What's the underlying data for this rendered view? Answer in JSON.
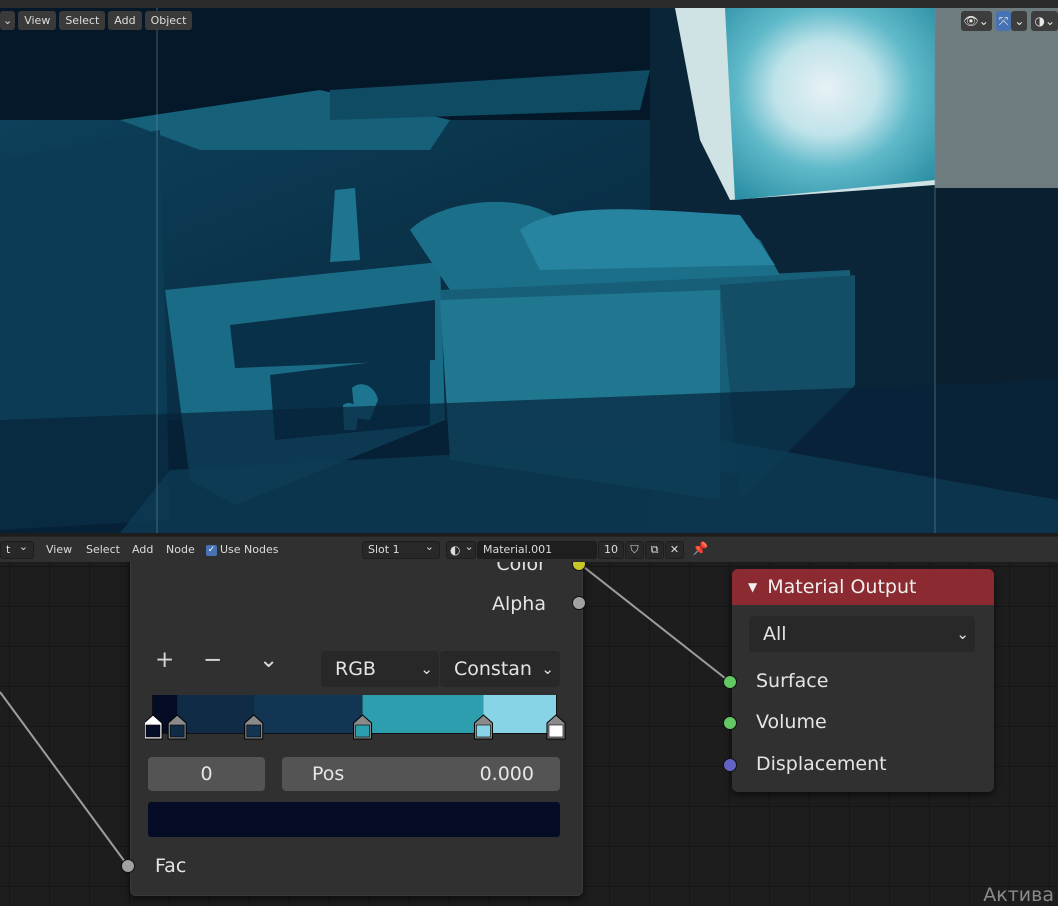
{
  "viewport": {
    "menu": [
      "View",
      "Select",
      "Add",
      "Object"
    ]
  },
  "node_editor": {
    "header": {
      "mode_partial": "t",
      "menu": [
        "View",
        "Select",
        "Add",
        "Node"
      ],
      "use_nodes_label": "Use Nodes",
      "use_nodes_checked": true,
      "slot": "Slot 1",
      "material_name": "Material.001",
      "user_count": "10"
    },
    "color_ramp": {
      "output_color": "Color",
      "output_alpha": "Alpha",
      "color_mode": "RGB",
      "interpolation": "Constan",
      "active_index": "0",
      "pos_label": "Pos",
      "pos_value": "0.000",
      "active_color": "#050c26",
      "input_fac": "Fac",
      "stops": [
        {
          "pos": 0.0,
          "color": "#050c26"
        },
        {
          "pos": 0.06,
          "color": "#0f2b45"
        },
        {
          "pos": 0.25,
          "color": "#113552"
        },
        {
          "pos": 0.52,
          "color": "#2d9eae"
        },
        {
          "pos": 0.82,
          "color": "#86d4e6"
        },
        {
          "pos": 1.0,
          "color": "#ffffff"
        }
      ]
    },
    "material_output": {
      "title": "Material Output",
      "target": "All",
      "inputs": [
        "Surface",
        "Volume",
        "Displacement"
      ],
      "header_color": "#8b2a30"
    },
    "watermark": "Актива"
  }
}
